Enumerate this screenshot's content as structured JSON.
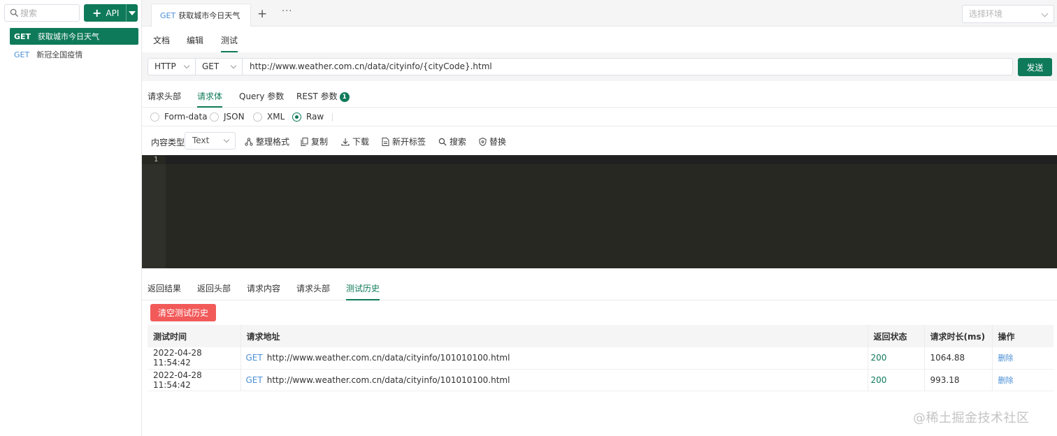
{
  "sidebar": {
    "search_placeholder": "搜索",
    "add_button_label": "API",
    "items": [
      {
        "method": "GET",
        "name": "获取城市今日天气",
        "active": true
      },
      {
        "method": "GET",
        "name": "新冠全国疫情",
        "active": false
      }
    ]
  },
  "topbar": {
    "doc_tab": {
      "method": "GET",
      "name": "获取城市今日天气"
    },
    "more_label": "···",
    "env_placeholder": "选择环境"
  },
  "view_tabs": [
    "文档",
    "编辑",
    "测试"
  ],
  "request": {
    "protocol": "HTTP",
    "method": "GET",
    "url": "http://www.weather.com.cn/data/cityinfo/{cityCode}.html",
    "send_label": "发送"
  },
  "request_tabs": {
    "headers": "请求头部",
    "body": "请求体",
    "query": "Query 参数",
    "rest": "REST 参数",
    "rest_count": "1"
  },
  "body_types": {
    "form": "Form-data",
    "json": "JSON",
    "xml": "XML",
    "raw": "Raw",
    "selected": "Raw"
  },
  "toolbar": {
    "content_type_label": "内容类型",
    "content_type_value": "Text",
    "format": "整理格式",
    "copy": "复制",
    "download": "下载",
    "new_tab": "新开标签",
    "search": "搜索",
    "replace": "替换"
  },
  "editor": {
    "line_number": "1"
  },
  "response_tabs": [
    "返回结果",
    "返回头部",
    "请求内容",
    "请求头部",
    "测试历史"
  ],
  "clear_history_label": "清空测试历史",
  "history": {
    "columns": [
      "测试时间",
      "请求地址",
      "返回状态",
      "请求时长(ms)",
      "操作"
    ],
    "rows": [
      {
        "time": "2022-04-28 11:54:42",
        "method": "GET",
        "url": "http://www.weather.com.cn/data/cityinfo/101010100.html",
        "status": "200",
        "duration": "1064.88",
        "action": "删除"
      },
      {
        "time": "2022-04-28 11:54:42",
        "method": "GET",
        "url": "http://www.weather.com.cn/data/cityinfo/101010100.html",
        "status": "200",
        "duration": "993.18",
        "action": "删除"
      }
    ]
  },
  "watermark": "@稀土掘金技术社区",
  "colors": {
    "accent": "#0f7a5a",
    "danger": "#f25a5a",
    "method_blue": "#4a8fd6",
    "editor_bg": "#272822"
  }
}
